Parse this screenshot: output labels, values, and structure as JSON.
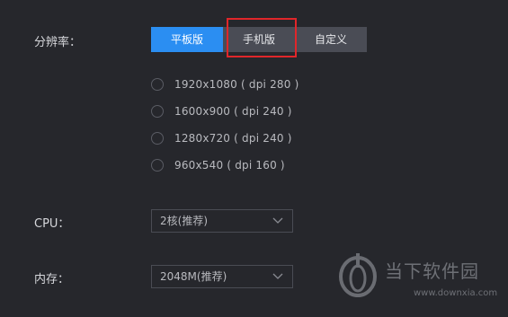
{
  "resolution": {
    "label": "分辨率：",
    "tabs": [
      {
        "label": "平板版",
        "active": true
      },
      {
        "label": "手机版",
        "active": false
      },
      {
        "label": "自定义",
        "active": false
      }
    ],
    "options": [
      "1920x1080 ( dpi 280 )",
      "1600x900 ( dpi 240 )",
      "1280x720 ( dpi 240 )",
      "960x540 ( dpi 160 )"
    ]
  },
  "cpu": {
    "label": "CPU：",
    "value": "2核(推荐)"
  },
  "memory": {
    "label": "内存：",
    "value": "2048M(推荐)"
  },
  "watermark": {
    "title": "当下软件园",
    "url": "www.downxia.com"
  },
  "colors": {
    "background": "#26272c",
    "active_tab": "#2b8ef2",
    "tab": "#4a4c55",
    "highlight_box": "#e0262a"
  }
}
